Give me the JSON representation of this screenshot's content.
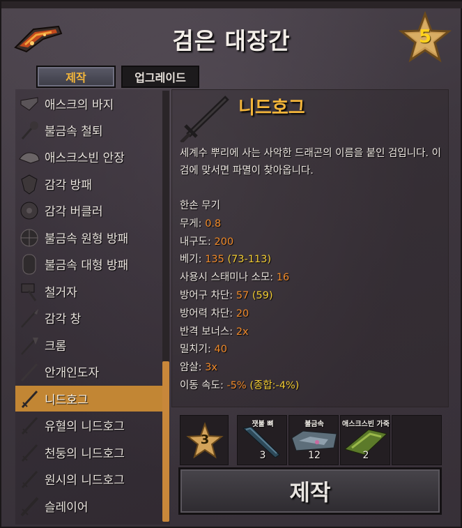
{
  "station": {
    "title": "검은 대장간",
    "level": "5",
    "icon": "black-forge-icon"
  },
  "tabs": {
    "craft": "제작",
    "upgrade": "업그레이드"
  },
  "recipes": [
    {
      "label": "애스크의 바지",
      "icon": "trousers-icon"
    },
    {
      "label": "불금속 철퇴",
      "icon": "mace-icon"
    },
    {
      "label": "애스크스빈 안장",
      "icon": "saddle-icon"
    },
    {
      "label": "감각 방패",
      "icon": "shield-icon"
    },
    {
      "label": "감각 버클러",
      "icon": "buckler-icon"
    },
    {
      "label": "불금속 원형 방패",
      "icon": "round-shield-icon"
    },
    {
      "label": "불금속 대형 방패",
      "icon": "tower-shield-icon"
    },
    {
      "label": "철거자",
      "icon": "sledge-icon"
    },
    {
      "label": "감각 창",
      "icon": "spear-icon"
    },
    {
      "label": "크롬",
      "icon": "atgeir-icon"
    },
    {
      "label": "안개인도자",
      "icon": "staff-icon"
    },
    {
      "label": "니드호그",
      "icon": "sword-icon",
      "selected": true
    },
    {
      "label": "유혈의 니드호그",
      "icon": "sword-icon"
    },
    {
      "label": "천둥의 니드호그",
      "icon": "sword-icon"
    },
    {
      "label": "원시의 니드호그",
      "icon": "sword-icon"
    },
    {
      "label": "슬레이어",
      "icon": "greatsword-icon"
    }
  ],
  "scroll": {
    "position": 0.95
  },
  "item": {
    "name": "니드호그",
    "icon": "sword-icon",
    "description": "세계수 뿌리에 사는 사악한 드래곤의 이름을 붙인 검입니다. 이 검에 맞서면 파멸이 찾아옵니다.",
    "stats": [
      {
        "label": "한손 무기",
        "value": "",
        "bonus": ""
      },
      {
        "label": "무게: ",
        "value": "0.8",
        "bonus": ""
      },
      {
        "label": "내구도: ",
        "value": "200",
        "bonus": ""
      },
      {
        "label": "베기: ",
        "value": "135",
        "bonus": " (73-113)"
      },
      {
        "label": "사용시 스태미나 소모: ",
        "value": "16",
        "bonus": ""
      },
      {
        "label": "방어구 차단: ",
        "value": "57",
        "bonus": " (59)"
      },
      {
        "label": "방어력 차단: ",
        "value": "20",
        "bonus": ""
      },
      {
        "label": "반격 보너스: ",
        "value": "2x",
        "bonus": ""
      },
      {
        "label": "밀치기: ",
        "value": "40",
        "bonus": ""
      },
      {
        "label": "암살: ",
        "value": "3x",
        "bonus": ""
      },
      {
        "label": "이동 속도: ",
        "value": "-5%",
        "bonus": " (종합:-4%)"
      }
    ]
  },
  "requirements": {
    "station_level": "3",
    "materials": [
      {
        "name": "잿불 뼈",
        "qty": "3",
        "icon": "ember-bone-icon"
      },
      {
        "name": "불금속",
        "qty": "12",
        "icon": "flametal-icon"
      },
      {
        "name": "애스크스빈 가죽",
        "qty": "2",
        "icon": "asksvin-hide-icon"
      }
    ]
  },
  "craft_button": "제작",
  "colors": {
    "accent": "#c28634",
    "highlight": "#f08a2a",
    "bonus": "#f2cc33",
    "gold": "#f3b53a"
  }
}
